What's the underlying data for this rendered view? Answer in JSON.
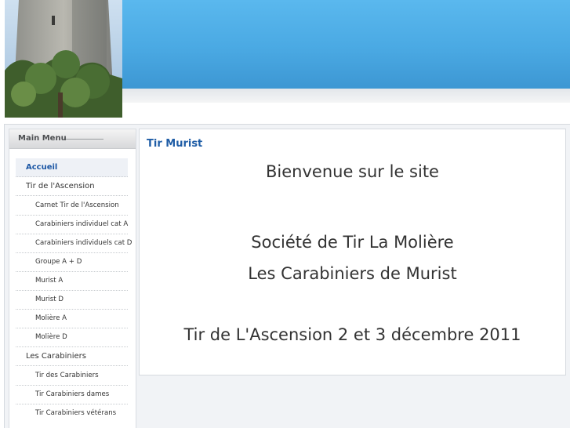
{
  "header": {
    "logo_alt": "tower-photo"
  },
  "menu": {
    "title": "Main Menu",
    "items": [
      {
        "label": "Accueil",
        "level": "top",
        "active": true
      },
      {
        "label": "Tir de l'Ascension",
        "level": "top"
      },
      {
        "label": "Carnet Tir de l'Ascension",
        "level": "sub"
      },
      {
        "label": "Carabiniers individuel cat A",
        "level": "sub"
      },
      {
        "label": "Carabiniers individuels cat D",
        "level": "sub"
      },
      {
        "label": "Groupe A + D",
        "level": "sub"
      },
      {
        "label": "Murist A",
        "level": "sub"
      },
      {
        "label": "Murist D",
        "level": "sub"
      },
      {
        "label": "Molière A",
        "level": "sub"
      },
      {
        "label": "Molière D",
        "level": "sub"
      },
      {
        "label": "Les Carabiniers",
        "level": "top"
      },
      {
        "label": "Tir des Carabiniers",
        "level": "sub"
      },
      {
        "label": "Tir Carabiniers dames",
        "level": "sub"
      },
      {
        "label": "Tir Carabiniers vétérans",
        "level": "sub"
      }
    ]
  },
  "content": {
    "title": "Tir Murist",
    "welcome": "Bienvenue sur le site",
    "society": "Société de Tir La Molière",
    "carabiniers": "Les Carabiniers de Murist",
    "event": "Tir de L'Ascension 2 et 3 décembre 2011"
  }
}
